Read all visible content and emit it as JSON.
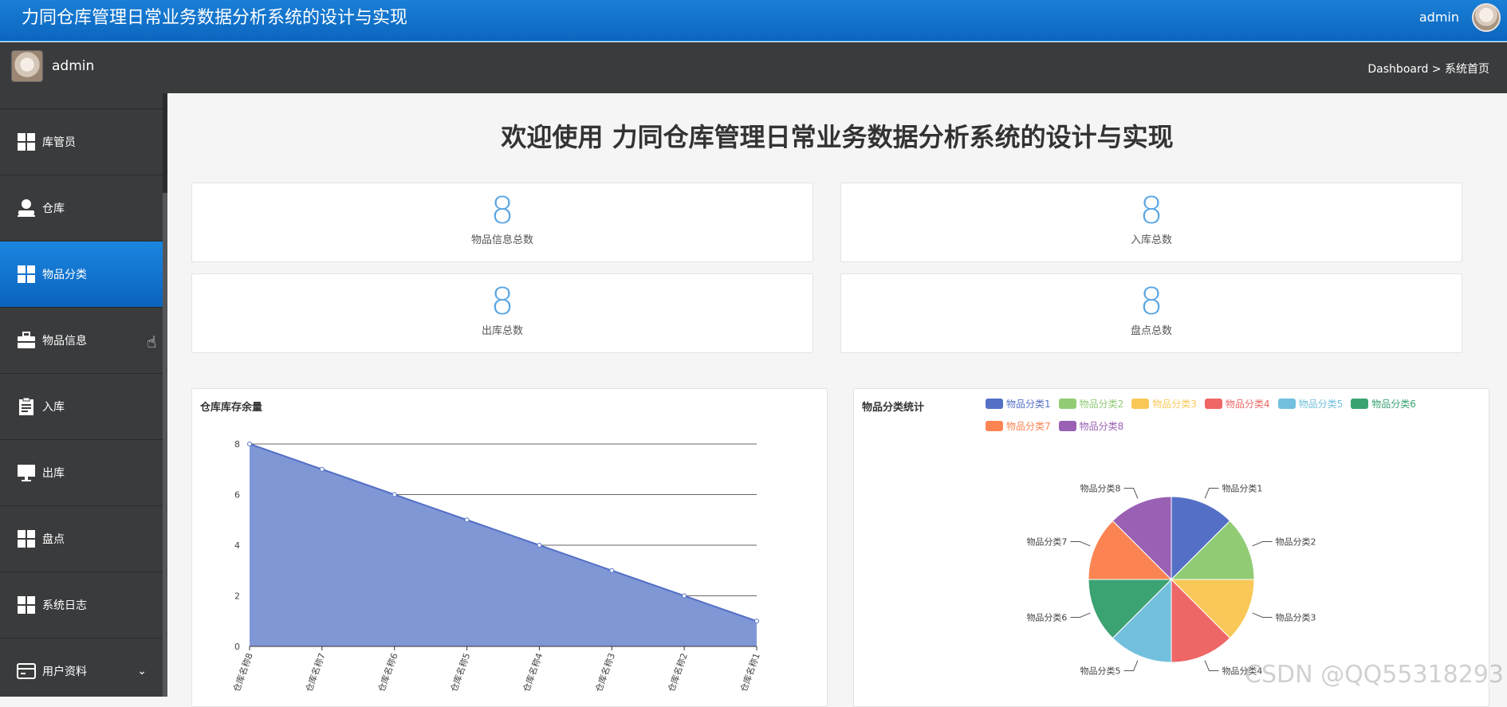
{
  "app": {
    "title": "力同仓库管理日常业务数据分析系统的设计与实现",
    "top_user": "admin"
  },
  "subbar": {
    "user": "admin",
    "breadcrumb": "Dashboard > 系统首页"
  },
  "sidebar": {
    "items": [
      {
        "label": "库管员",
        "icon": "grid-icon"
      },
      {
        "label": "仓库",
        "icon": "user-icon"
      },
      {
        "label": "物品分类",
        "icon": "grid-icon",
        "active": true
      },
      {
        "label": "物品信息",
        "icon": "briefcase-icon"
      },
      {
        "label": "入库",
        "icon": "clipboard-icon"
      },
      {
        "label": "出库",
        "icon": "monitor-icon"
      },
      {
        "label": "盘点",
        "icon": "grid-icon"
      },
      {
        "label": "系统日志",
        "icon": "grid-icon"
      },
      {
        "label": "用户资料",
        "icon": "card-icon",
        "chevron": "chevron-down-icon"
      }
    ]
  },
  "main": {
    "welcome": "欢迎使用 力同仓库管理日常业务数据分析系统的设计与实现",
    "stats": [
      {
        "value": "8",
        "label": "物品信息总数"
      },
      {
        "value": "8",
        "label": "入库总数"
      },
      {
        "value": "8",
        "label": "出库总数"
      },
      {
        "value": "8",
        "label": "盘点总数"
      }
    ]
  },
  "chart_data": [
    {
      "type": "area",
      "title": "仓库库存余量",
      "categories": [
        "仓库名称8",
        "仓库名称7",
        "仓库名称6",
        "仓库名称5",
        "仓库名称4",
        "仓库名称3",
        "仓库名称2",
        "仓库名称1"
      ],
      "values": [
        8,
        7,
        6,
        5,
        4,
        3,
        2,
        1
      ],
      "ylim": [
        0,
        8
      ],
      "yticks": [
        0,
        2,
        4,
        6,
        8
      ],
      "grid": true,
      "color": "#5470c6",
      "fill": "#8097d6"
    },
    {
      "type": "pie",
      "title": "物品分类统计",
      "labels": [
        "物品分类1",
        "物品分类2",
        "物品分类3",
        "物品分类4",
        "物品分类5",
        "物品分类6",
        "物品分类7",
        "物品分类8"
      ],
      "values": [
        1,
        1,
        1,
        1,
        1,
        1,
        1,
        1
      ],
      "colors": [
        "#5470c6",
        "#91cc75",
        "#fac858",
        "#ee6666",
        "#73c0de",
        "#3ba272",
        "#fc8452",
        "#9a60b4"
      ],
      "legend": "top-right"
    }
  ],
  "watermark": "CSDN @QQ55318293"
}
